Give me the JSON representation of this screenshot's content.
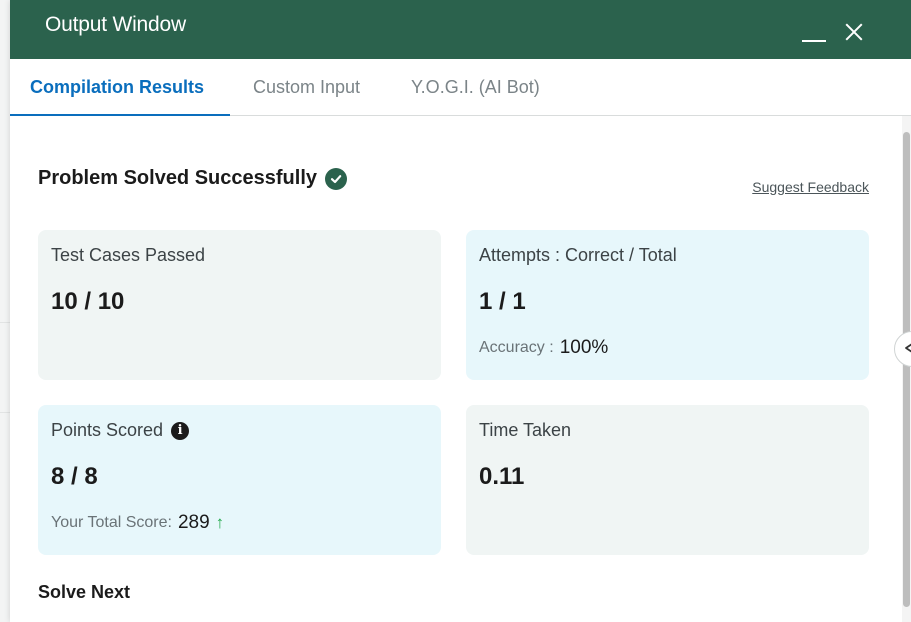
{
  "window": {
    "title": "Output Window"
  },
  "tabs": [
    {
      "label": "Compilation Results",
      "active": true
    },
    {
      "label": "Custom Input",
      "active": false
    },
    {
      "label": "Y.O.G.I. (AI Bot)",
      "active": false
    }
  ],
  "result": {
    "status": "Problem Solved Successfully",
    "status_icon": "check-circle-icon",
    "feedback_link": "Suggest Feedback"
  },
  "cards": {
    "test_cases": {
      "label": "Test Cases Passed",
      "value": "10 / 10"
    },
    "attempts": {
      "label": "Attempts : Correct / Total",
      "value": "1 / 1",
      "sub_label": "Accuracy :",
      "sub_value": "100%"
    },
    "points": {
      "label": "Points Scored",
      "value": "8 / 8",
      "sub_label": "Your Total Score:",
      "sub_value": "289",
      "icon": "info-icon",
      "trend_icon": "arrow-up-icon"
    },
    "time": {
      "label": "Time Taken",
      "value": "0.11"
    }
  },
  "solve_next": {
    "label": "Solve Next"
  },
  "colors": {
    "titlebar": "#2b624d",
    "active_tab": "#0a6ebd",
    "card_grey": "#f0f5f4",
    "card_blue": "#e7f7fb",
    "trend_up": "#1fa84a"
  }
}
